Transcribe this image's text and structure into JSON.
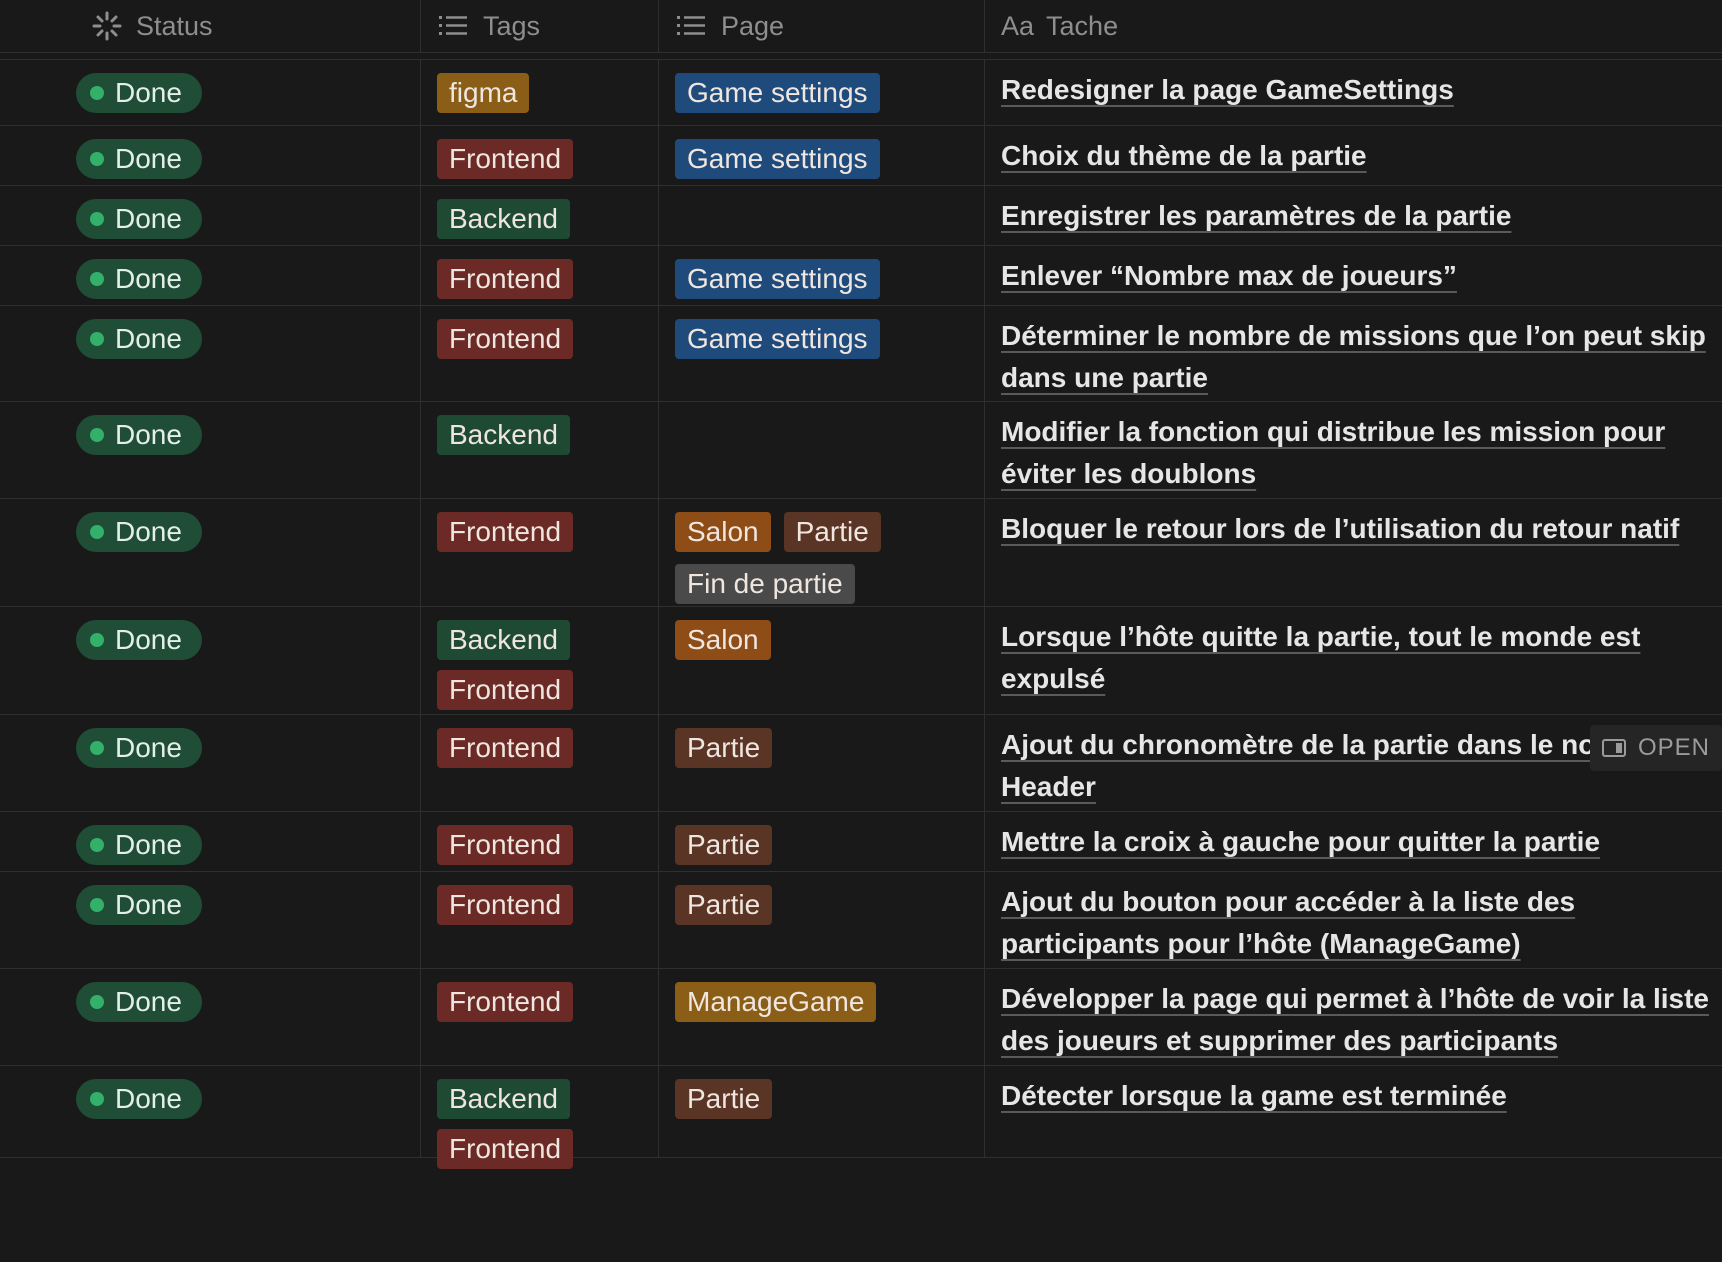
{
  "columns": {
    "status": "Status",
    "tags": "Tags",
    "page": "Page",
    "task_prefix": "Aa",
    "task": "Tache"
  },
  "colors": {
    "figma": "#8a5e16",
    "Frontend": "#6b2a26",
    "Backend": "#1e4a33",
    "Game settings": "#1f4b7c",
    "Salon": "#8e4c16",
    "Partie": "#5a3424",
    "Fin de partie": "#4a4a4a",
    "ManageGame": "#8a5e16"
  },
  "open_label": "OPEN",
  "rows": [
    {
      "status": "Done",
      "tags": [
        "figma"
      ],
      "pages": [
        "Game settings"
      ],
      "task": "Redesigner la page GameSettings"
    },
    {
      "status": "Done",
      "tags": [
        "Frontend"
      ],
      "pages": [
        "Game settings"
      ],
      "task": "Choix du thème de la partie"
    },
    {
      "status": "Done",
      "tags": [
        "Backend"
      ],
      "pages": [],
      "task": "Enregistrer les paramètres de la partie"
    },
    {
      "status": "Done",
      "tags": [
        "Frontend"
      ],
      "pages": [
        "Game settings"
      ],
      "task": "Enlever “Nombre max de joueurs”"
    },
    {
      "status": "Done",
      "tags": [
        "Frontend"
      ],
      "pages": [
        "Game settings"
      ],
      "task": "Déterminer le nombre de missions que l’on peut skip dans une partie"
    },
    {
      "status": "Done",
      "tags": [
        "Backend"
      ],
      "pages": [],
      "task": "Modifier la fonction qui distribue les mission pour éviter les doublons"
    },
    {
      "status": "Done",
      "tags": [
        "Frontend"
      ],
      "pages": [
        "Salon",
        "Partie",
        "Fin de partie"
      ],
      "task": "Bloquer le retour lors de l’utilisation du retour natif"
    },
    {
      "status": "Done",
      "tags": [
        "Backend",
        "Frontend"
      ],
      "pages": [
        "Salon"
      ],
      "task": "Lorsque l’hôte quitte la partie, tout le monde est expulsé"
    },
    {
      "status": "Done",
      "tags": [
        "Frontend"
      ],
      "pages": [
        "Partie"
      ],
      "task": "Ajout du chronomètre de la partie dans le nouveau Header"
    },
    {
      "status": "Done",
      "tags": [
        "Frontend"
      ],
      "pages": [
        "Partie"
      ],
      "task": "Mettre la croix à gauche pour quitter la partie"
    },
    {
      "status": "Done",
      "tags": [
        "Frontend"
      ],
      "pages": [
        "Partie"
      ],
      "task": "Ajout du bouton pour accéder à la liste des participants pour l’hôte (ManageGame)"
    },
    {
      "status": "Done",
      "tags": [
        "Frontend"
      ],
      "pages": [
        "ManageGame"
      ],
      "task": "Développer la page qui permet à l’hôte de voir la liste des joueurs et supprimer des participants"
    },
    {
      "status": "Done",
      "tags": [
        "Backend",
        "Frontend"
      ],
      "pages": [
        "Partie"
      ],
      "task": "Détecter lorsque la game est terminée"
    }
  ]
}
